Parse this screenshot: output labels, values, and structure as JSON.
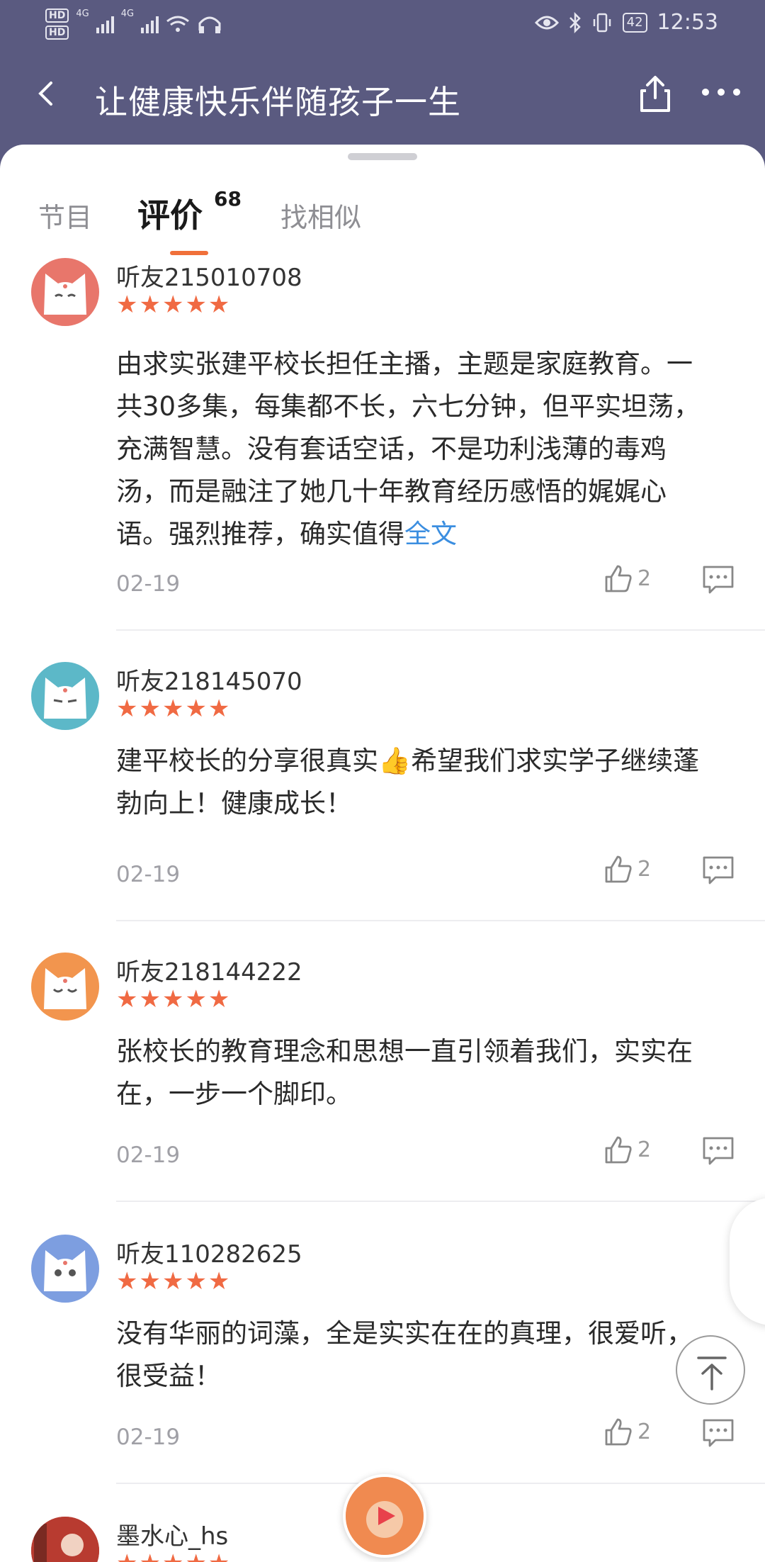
{
  "status_bar": {
    "hd1": "HD",
    "hd2": "HD",
    "net1": "4G",
    "net2": "4G",
    "battery": "42",
    "time": "12:53"
  },
  "nav": {
    "title": "让健康快乐伴随孩子一生",
    "back_icon": "chevron-left-icon",
    "share_icon": "share-icon",
    "more_icon": "more-dots-icon"
  },
  "tabs": {
    "programs": "节目",
    "reviews": "评价",
    "reviews_count": "68",
    "similar": "找相似"
  },
  "colors": {
    "accent": "#f0703a",
    "stars": "#f06a43",
    "link": "#3b8ee0",
    "header_bg": "#5a5a80"
  },
  "reviews": [
    {
      "username": "听友215010708",
      "stars": "★★★★★",
      "rating": 5,
      "content": "由求实张建平校长担任主播，主题是家庭教育。一共30多集，每集都不长，六七分钟，但平实坦荡，充满智慧。没有套话空话，不是功利浅薄的毒鸡汤，而是融注了她几十年教育经历感悟的娓娓心语。强烈推荐，确实值得",
      "more_link": "全文",
      "date": "02-19",
      "likes": "2",
      "avatar_color": "#e8766b"
    },
    {
      "username": "听友218145070",
      "stars": "★★★★★",
      "rating": 5,
      "content": "建平校长的分享很真实👍希望我们求实学子继续蓬勃向上！健康成长！",
      "date": "02-19",
      "likes": "2",
      "avatar_color": "#5cb8c8"
    },
    {
      "username": "听友218144222",
      "stars": "★★★★★",
      "rating": 5,
      "content": "张校长的教育理念和思想一直引领着我们，实实在在，一步一个脚印。",
      "date": "02-19",
      "likes": "2",
      "avatar_color": "#f2954e"
    },
    {
      "username": "听友110282625",
      "stars": "★★★★★",
      "rating": 5,
      "content": "没有华丽的词藻，全是实实在在的真理，很爱听，很受益！",
      "date": "02-19",
      "likes": "2",
      "avatar_color": "#7d9ee0"
    },
    {
      "username": "墨水心_hs",
      "stars": "★★★★★",
      "rating": 5,
      "avatar_color": "#c94a3a"
    }
  ]
}
